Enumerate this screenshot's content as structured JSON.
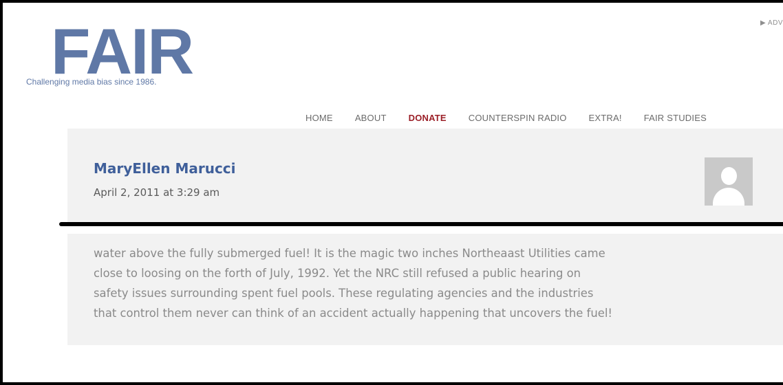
{
  "site": {
    "logo_text": "FAIR",
    "tagline": "Challenging media bias since 1986.",
    "top_link": "▶ ADV"
  },
  "nav": {
    "items": [
      {
        "label": "HOME"
      },
      {
        "label": "ABOUT"
      },
      {
        "label": "DONATE"
      },
      {
        "label": "COUNTERSPIN RADIO"
      },
      {
        "label": "EXTRA!"
      },
      {
        "label": "FAIR STUDIES"
      }
    ]
  },
  "comment": {
    "author": "MaryEllen Marucci",
    "date": "April 2, 2011 at 3:29 am",
    "avatar_icon": "default-avatar-icon",
    "text": "water above the fully submerged fuel! It is the magic two inches Northeaast Utilities came\nclose to loosing on the forth of July, 1992. Yet the NRC still refused a public hearing on\nsafety issues surrounding spent fuel pools. These regulating agencies and the industries\nthat control them never can think of an accident actually happening that uncovers the fuel!"
  },
  "colors": {
    "brand": "#5f78a6",
    "donate": "#9b1f27",
    "panel": "#f2f2f2"
  }
}
